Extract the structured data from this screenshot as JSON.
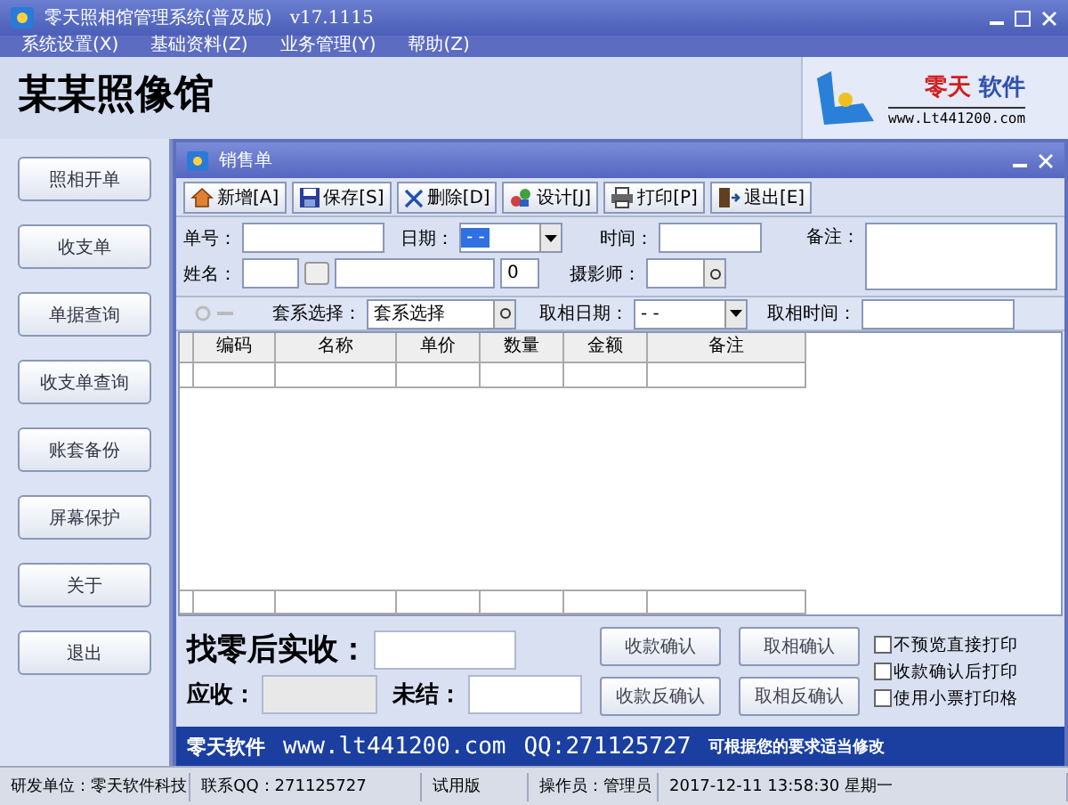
{
  "window": {
    "title": "零天照相馆管理系统(普及版)",
    "version": "v17.1115"
  },
  "menu": [
    "系统设置(X)",
    "基础资料(Z)",
    "业务管理(Y)",
    "帮助(Z)"
  ],
  "shop_name": "某某照像馆",
  "logo": {
    "name": "零天",
    "suffix": "软件",
    "url": "www.Lt441200.com"
  },
  "sidebar": [
    "照相开单",
    "收支单",
    "单据查询",
    "收支单查询",
    "账套备份",
    "屏幕保护",
    "关于",
    "退出"
  ],
  "form_window": {
    "title": "销售单",
    "toolbar": [
      "新增[A]",
      "保存[S]",
      "删除[D]",
      "设计[J]",
      "打印[P]",
      "退出[E]"
    ],
    "fields": {
      "order_no": {
        "label": "单号："
      },
      "date": {
        "label": "日期：",
        "value": "- -"
      },
      "time": {
        "label": "时间："
      },
      "note": {
        "label": "备注："
      },
      "name": {
        "label": "姓名："
      },
      "count": {
        "value": "0"
      },
      "photographer": {
        "label": "摄影师："
      }
    },
    "package": {
      "label": "套系选择：",
      "value": "套系选择"
    },
    "pickup_date": {
      "label": "取相日期：",
      "value": "- -"
    },
    "pickup_time": {
      "label": "取相时间："
    },
    "table": {
      "columns": [
        "编码",
        "名称",
        "单价",
        "数量",
        "金额",
        "备注"
      ]
    },
    "change_received": {
      "label": "找零后实收："
    },
    "receivable": {
      "label": "应收："
    },
    "unsettled": {
      "label": "未结："
    },
    "buttons": [
      "收款确认",
      "取相确认",
      "收款反确认",
      "取相反确认"
    ],
    "options": [
      {
        "label": "不预览直接打印",
        "checked": false
      },
      {
        "label": "收款确认后打印",
        "checked": false
      },
      {
        "label": "使用小票打印格",
        "checked": false
      }
    ],
    "banner": {
      "brand": "零天软件",
      "url": "www.lt441200.com",
      "qq": "QQ:271125727",
      "slogan": "可根据您的要求适当修改"
    }
  },
  "status_bar": [
    "研发单位：零天软件科技",
    "联系QQ：271125727",
    "试用版",
    "操作员：管理员",
    "2017-12-11 13:58:30 星期一"
  ]
}
